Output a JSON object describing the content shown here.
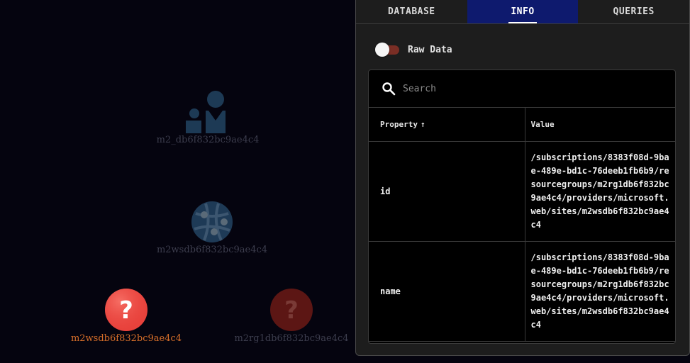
{
  "graph": {
    "nodes": [
      {
        "label": "m2_db6f832bc9ae4c4",
        "icon": "users-icon",
        "state": "dimmed"
      },
      {
        "label": "m2wsdb6f832bc9ae4c4",
        "icon": "web-app-icon",
        "state": "dimmed"
      },
      {
        "label": "m2wsdb6f832bc9ae4c4",
        "icon": "question-icon",
        "state": "selected",
        "color": "#e8413b"
      },
      {
        "label": "m2rg1db6f832bc9ae4c4",
        "icon": "question-icon",
        "state": "dimmed",
        "color": "#6b1a18"
      }
    ]
  },
  "panel": {
    "tabs": [
      {
        "label": "DATABASE",
        "active": false
      },
      {
        "label": "INFO",
        "active": true
      },
      {
        "label": "QUERIES",
        "active": false
      }
    ],
    "raw_data_toggle": {
      "label": "Raw Data",
      "on": false
    },
    "search": {
      "placeholder": "Search"
    },
    "table": {
      "columns": [
        "Property",
        "Value"
      ],
      "sort_indicator": "↑",
      "rows": [
        {
          "property": "id",
          "value": "/subscriptions/8383f08d-9bae-489e-bd1c-76deeb1fb6b9/resourcegroups/m2rg1db6f832bc9ae4c4/providers/microsoft.web/sites/m2wsdb6f832bc9ae4c4"
        },
        {
          "property": "name",
          "value": "/subscriptions/8383f08d-9bae-489e-bd1c-76deeb1fb6b9/resourcegroups/m2rg1db6f832bc9ae4c4/providers/microsoft.web/sites/m2wsdb6f832bc9ae4c4"
        }
      ]
    }
  },
  "colors": {
    "accent": "#0e1a6e",
    "toggle_track": "#7a2e25",
    "selected_label": "#d86f2a"
  }
}
